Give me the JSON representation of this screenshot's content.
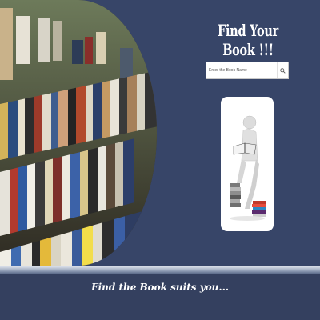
{
  "header": {
    "title": "Find Your Book !!!"
  },
  "search": {
    "placeholder": "Enter the Book Name",
    "value": "",
    "icon": "search-icon"
  },
  "illustration": {
    "icon": "person-reading-on-books-icon"
  },
  "footer": {
    "tagline": "Find the Book suits you..."
  },
  "colors": {
    "background": "#374568",
    "footer": "#34405f",
    "title_text": "#ffffff"
  }
}
